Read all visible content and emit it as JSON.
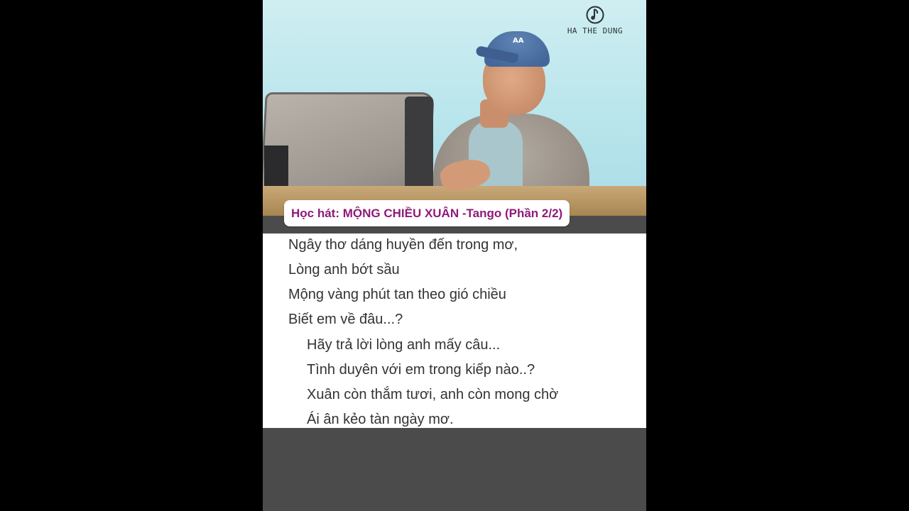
{
  "watermark": {
    "text": "HA THE DUNG",
    "icon": "music-note-icon"
  },
  "title": {
    "text": "Học hát: MỘNG CHIỀU XUÂN -Tango (Phần 2/2)",
    "color": "#8f1a78"
  },
  "lyrics": [
    "Ngây thơ dáng huyền đến trong mơ,",
    "Lòng anh bớt sầu",
    "Mộng vàng phút tan theo gió chiều",
    "Biết em về đâu...?",
    "Hãy trả lời lòng anh mấy câu...",
    "Tình duyên với em trong kiếp nào..?",
    "Xuân còn thắm tươi, anh còn mong chờ",
    "Ái ân kẻo tàn ngày mơ."
  ],
  "cap_logo": "AA"
}
